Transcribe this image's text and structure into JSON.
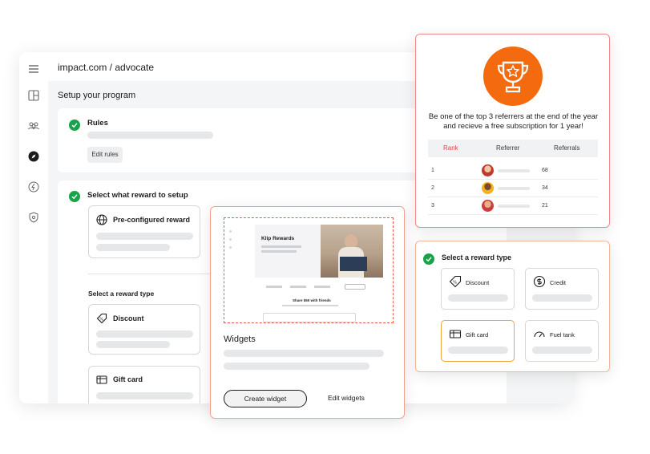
{
  "app": {
    "title": "impact.com / advocate",
    "setup_title": "Setup your program",
    "rules": {
      "title": "Rules",
      "edit_label": "Edit rules"
    },
    "reward_setup": {
      "title": "Select what reward to setup",
      "preconfigured_label": "Pre-configured reward",
      "reward_type_label": "Select a reward type",
      "discount_label": "Discount",
      "giftcard_label": "Gift card"
    },
    "nav_icons": [
      "menu-icon",
      "layout-icon",
      "users-icon",
      "compass-icon",
      "rewards-icon",
      "shield-icon"
    ]
  },
  "widgets": {
    "title": "Widgets",
    "create_label": "Create widget",
    "edit_label": "Edit widgets",
    "preview": {
      "brand": "Klip Rewards",
      "share_text": "Share $50 with friends"
    }
  },
  "leaderboard": {
    "promo": "Be one of the top 3 referrers at the end of the year and recieve a free subscription for 1 year!",
    "columns": [
      "Rank",
      "Referrer",
      "Referrals"
    ],
    "rows": [
      {
        "rank": "1",
        "referrals": "68"
      },
      {
        "rank": "2",
        "referrals": "34"
      },
      {
        "rank": "3",
        "referrals": "21"
      }
    ],
    "colors": {
      "accent": "#f46a0f",
      "rank_header": "#e04848"
    }
  },
  "reward_type": {
    "title": "Select a reward type",
    "options": [
      "Discount",
      "Credit",
      "Gift card",
      "Fuel tank"
    ],
    "selected": "Gift card"
  },
  "colors": {
    "success": "#18a34a",
    "border_red": "#f08a8a",
    "border_orange": "#f4a23a"
  }
}
